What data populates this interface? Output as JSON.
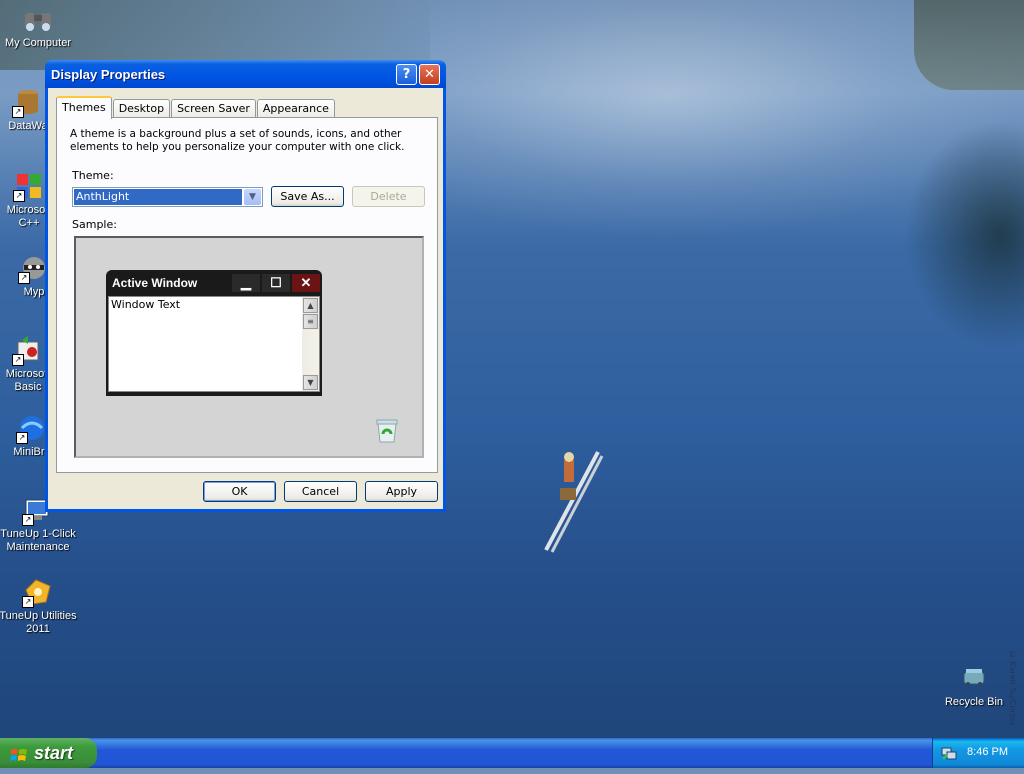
{
  "desktop": {
    "icons": [
      {
        "label": "My Computer"
      },
      {
        "label": "DataWa"
      },
      {
        "label": "Microsoft C++"
      },
      {
        "label": "Myp"
      },
      {
        "label": "Microsoft Basic"
      },
      {
        "label": "MiniBro"
      },
      {
        "label": "TuneUp 1-Click Maintenance"
      },
      {
        "label": "TuneUp Utilities 2011"
      },
      {
        "label": "Recycle Bin"
      }
    ],
    "watermark": "© Karen Su/Corbis"
  },
  "window": {
    "title": "Display Properties",
    "help_glyph": "?",
    "close_glyph": "✕",
    "tabs": [
      {
        "label": "Themes",
        "active": true
      },
      {
        "label": "Desktop"
      },
      {
        "label": "Screen Saver"
      },
      {
        "label": "Appearance"
      }
    ],
    "description": "A theme is a background plus a set of sounds, icons, and other elements to help you personalize your computer with one click.",
    "theme_label": "Theme:",
    "theme_value": "AnthLight",
    "save_as_label": "Save As...",
    "delete_label": "Delete",
    "sample_label": "Sample:",
    "sample": {
      "window_title": "Active Window",
      "window_text": "Window Text"
    },
    "ok_label": "OK",
    "cancel_label": "Cancel",
    "apply_label": "Apply"
  },
  "taskbar": {
    "start_label": "start",
    "clock": "8:46 PM"
  },
  "colors": {
    "accent": "#0055e5",
    "selection": "#316ac5",
    "start_green": "#3c9a3c"
  }
}
